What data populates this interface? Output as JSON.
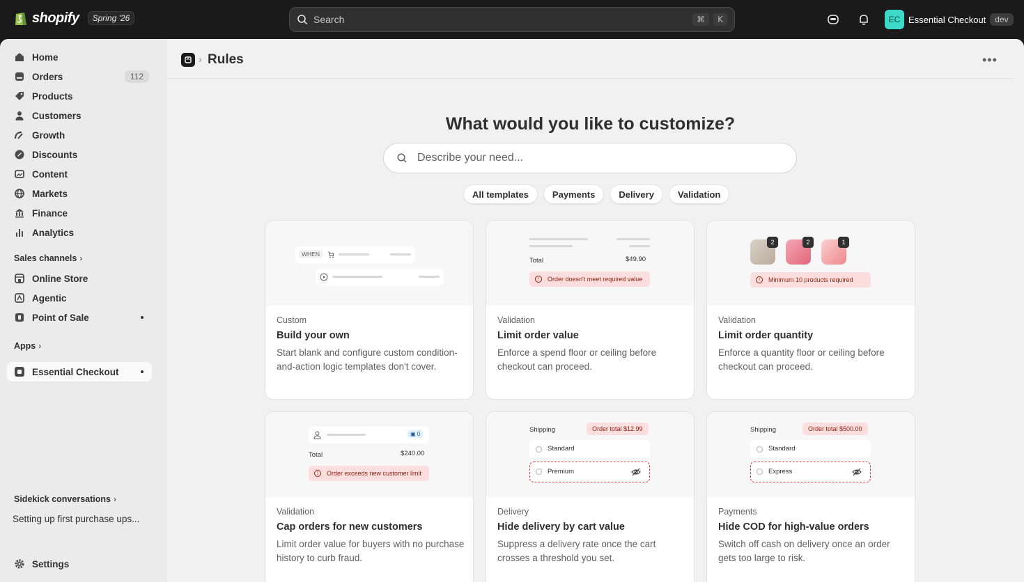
{
  "topbar": {
    "brand": "shopify",
    "edition": "Spring '26",
    "search_placeholder": "Search",
    "shortcut_cmd": "⌘",
    "shortcut_key": "K",
    "account_initials": "EC",
    "account_name": "Essential Checkout",
    "account_env": "dev"
  },
  "sidebar": {
    "items": [
      {
        "label": "Home",
        "icon": "home-icon"
      },
      {
        "label": "Orders",
        "icon": "orders-icon",
        "badge": "112"
      },
      {
        "label": "Products",
        "icon": "tag-icon"
      },
      {
        "label": "Customers",
        "icon": "person-icon"
      },
      {
        "label": "Growth",
        "icon": "growth-icon"
      },
      {
        "label": "Discounts",
        "icon": "discount-icon"
      },
      {
        "label": "Content",
        "icon": "content-icon"
      },
      {
        "label": "Markets",
        "icon": "globe-icon"
      },
      {
        "label": "Finance",
        "icon": "bank-icon"
      },
      {
        "label": "Analytics",
        "icon": "chart-icon"
      }
    ],
    "sales_channels_label": "Sales channels",
    "channels": [
      {
        "label": "Online Store",
        "icon": "store-icon"
      },
      {
        "label": "Agentic",
        "icon": "agentic-icon"
      },
      {
        "label": "Point of Sale",
        "icon": "pos-icon"
      }
    ],
    "apps_label": "Apps",
    "app_item": "Essential Checkout",
    "sidekick_label": "Sidekick conversations",
    "conversation": "Setting up first purchase ups...",
    "settings_label": "Settings"
  },
  "page": {
    "title": "Rules",
    "heading": "What would you like to customize?",
    "search_placeholder": "Describe your need...",
    "chips": [
      "All templates",
      "Payments",
      "Delivery",
      "Validation"
    ]
  },
  "cards": [
    {
      "category": "Custom",
      "title": "Build your own",
      "description": "Start blank and configure custom condition-and-action logic templates don't cover."
    },
    {
      "category": "Validation",
      "title": "Limit order value",
      "description": "Enforce a spend floor or ceiling before checkout can proceed."
    },
    {
      "category": "Validation",
      "title": "Limit order quantity",
      "description": "Enforce a quantity floor or ceiling before checkout can proceed."
    },
    {
      "category": "Validation",
      "title": "Cap orders for new customers",
      "description": "Limit order value for buyers with no purchase history to curb fraud."
    },
    {
      "category": "Delivery",
      "title": "Hide delivery by cart value",
      "description": "Suppress a delivery rate once the cart crosses a threshold you set."
    },
    {
      "category": "Payments",
      "title": "Hide COD for high-value orders",
      "description": "Switch off cash on delivery once an order gets too large to risk."
    }
  ],
  "previews": {
    "when": "WHEN",
    "total_label": "Total",
    "total_value": "$49.90",
    "err_value": "Order doesn't meet required value",
    "qty_badges": [
      "2",
      "2",
      "1"
    ],
    "err_quantity": "Minimum 10 products required",
    "cap_count": "0",
    "cap_total": "$240.00",
    "err_cap": "Order exceeds new customer limit",
    "shipping_label": "Shipping",
    "delivery_threshold": "Order total $12.99",
    "delivery_standard": "Standard",
    "delivery_premium": "Premium",
    "cod_threshold": "Order total $500.00",
    "cod_standard": "Standard",
    "cod_express": "Express"
  }
}
